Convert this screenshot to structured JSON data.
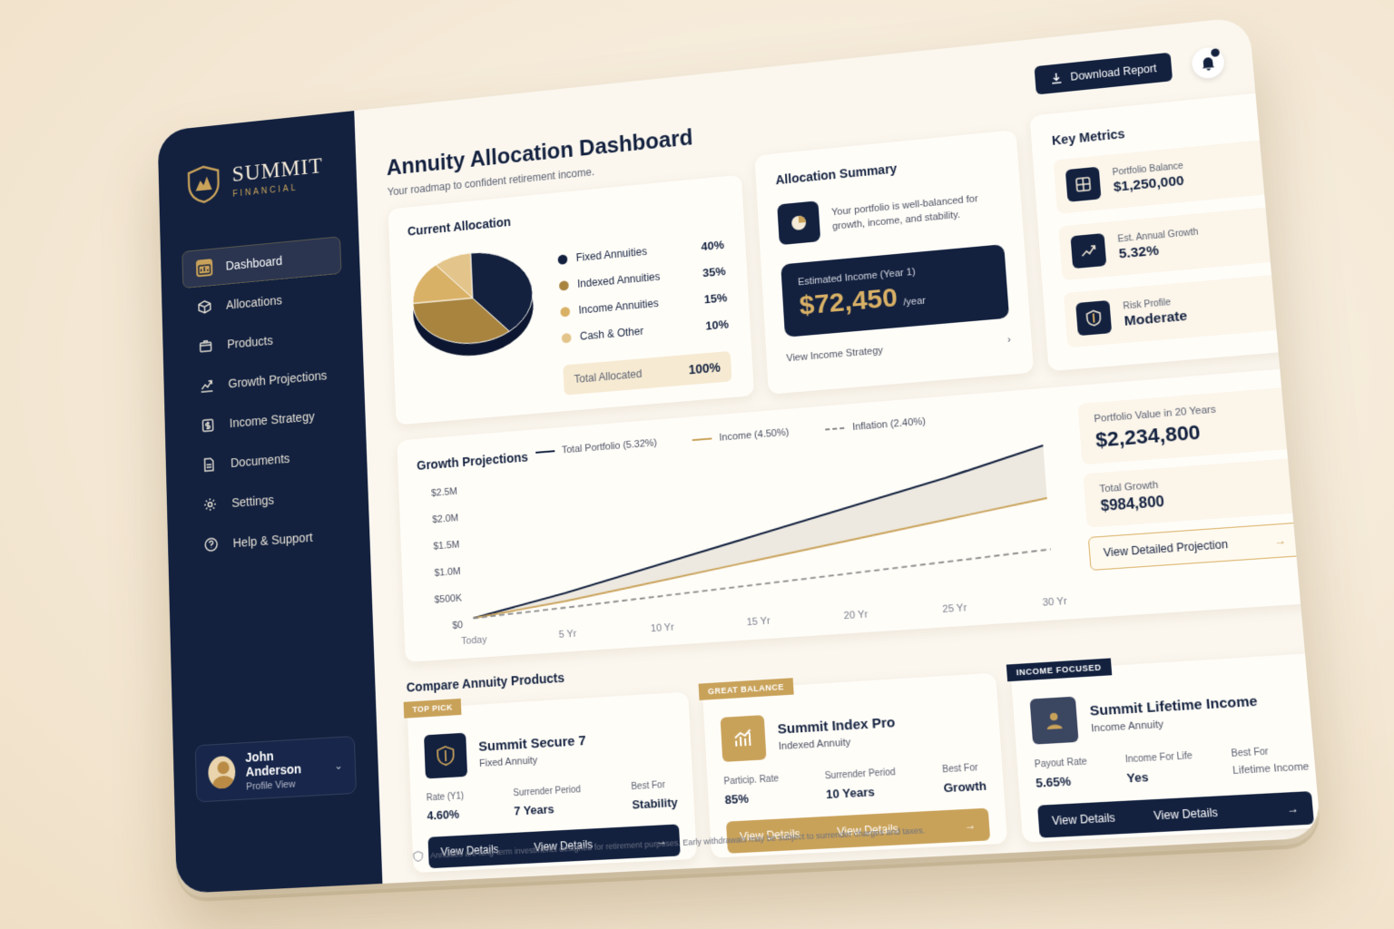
{
  "brand": {
    "name": "SUMMIT",
    "sub": "FINANCIAL"
  },
  "sidebar": {
    "items": [
      {
        "label": "Dashboard",
        "icon": "dashboard-icon"
      },
      {
        "label": "Allocations",
        "icon": "cube-icon"
      },
      {
        "label": "Products",
        "icon": "box-icon"
      },
      {
        "label": "Growth Projections",
        "icon": "chart-icon"
      },
      {
        "label": "Income Strategy",
        "icon": "money-icon"
      },
      {
        "label": "Documents",
        "icon": "document-icon"
      },
      {
        "label": "Settings",
        "icon": "gear-icon"
      },
      {
        "label": "Help & Support",
        "icon": "help-icon"
      }
    ],
    "profile": {
      "name": "John Anderson",
      "sub": "Profile View"
    }
  },
  "header": {
    "title": "Annuity Allocation Dashboard",
    "subtitle": "Your roadmap to confident retirement income.",
    "download_label": "Download Report"
  },
  "allocation": {
    "title": "Current Allocation",
    "items": [
      {
        "label": "Fixed Annuities",
        "pct": "40%",
        "color": "#13213f"
      },
      {
        "label": "Indexed Annuities",
        "pct": "35%",
        "color": "#a8843f"
      },
      {
        "label": "Income Annuities",
        "pct": "15%",
        "color": "#d9b166"
      },
      {
        "label": "Cash & Other",
        "pct": "10%",
        "color": "#e3c48a"
      }
    ],
    "total_label": "Total Allocated",
    "total_value": "100%"
  },
  "summary": {
    "title": "Allocation Summary",
    "text": "Your portfolio is well-balanced for growth, income, and stability.",
    "income_label": "Estimated Income (Year 1)",
    "income_value": "$72,450",
    "income_unit": "/year",
    "link": "View Income Strategy"
  },
  "metrics": {
    "title": "Key Metrics",
    "items": [
      {
        "label": "Portfolio Balance",
        "value": "$1,250,000"
      },
      {
        "label": "Est. Annual Growth",
        "value": "5.32%"
      },
      {
        "label": "Risk Profile",
        "value": "Moderate"
      }
    ]
  },
  "growth": {
    "title": "Growth Projections",
    "stat1_label": "Portfolio Value in 20 Years",
    "stat1_value": "$2,234,800",
    "stat2_label": "Total Growth",
    "stat2_value": "$984,800",
    "button": "View Detailed Projection"
  },
  "chart_data": {
    "type": "line",
    "title": "Growth Projections",
    "x": [
      "Today",
      "5 Yr",
      "10 Yr",
      "15 Yr",
      "20 Yr",
      "25 Yr",
      "30 Yr"
    ],
    "series": [
      {
        "name": "Total Portfolio (5.32%)",
        "values": [
          0.1,
          0.45,
          0.85,
          1.25,
          1.65,
          2.05,
          2.5
        ],
        "color": "#13213f",
        "dash": false
      },
      {
        "name": "Income (4.50%)",
        "values": [
          0.1,
          0.3,
          0.55,
          0.8,
          1.05,
          1.3,
          1.55
        ],
        "color": "#c9a25a",
        "dash": false
      },
      {
        "name": "Inflation (2.40%)",
        "values": [
          0.1,
          0.18,
          0.27,
          0.36,
          0.45,
          0.54,
          0.63
        ],
        "color": "#8a8a8a",
        "dash": true
      }
    ],
    "y_ticks": [
      "$0",
      "$500K",
      "$1.0M",
      "$1.5M",
      "$2.0M",
      "$2.5M"
    ],
    "ylim": [
      0,
      2.5
    ],
    "grid": false,
    "legend": "top"
  },
  "compare": {
    "title": "Compare Annuity Products",
    "products": [
      {
        "ribbon": "TOP PICK",
        "name": "Summit Secure 7",
        "type": "Fixed Annuity",
        "stats": [
          {
            "label": "Rate (Y1)",
            "value": "4.60%"
          },
          {
            "label": "Surrender Period",
            "value": "7 Years"
          },
          {
            "label": "Best For",
            "value": "Stability"
          }
        ],
        "btn1": "View Details",
        "btn2": "View Details"
      },
      {
        "ribbon": "GREAT BALANCE",
        "name": "Summit Index Pro",
        "type": "Indexed Annuity",
        "stats": [
          {
            "label": "Particip. Rate",
            "value": "85%"
          },
          {
            "label": "Surrender Period",
            "value": "10 Years"
          },
          {
            "label": "Best For",
            "value": "Growth"
          }
        ],
        "btn1": "View Details",
        "btn2": "View Details"
      },
      {
        "ribbon": "INCOME FOCUSED",
        "name": "Summit Lifetime Income",
        "type": "Income Annuity",
        "stats": [
          {
            "label": "Payout Rate",
            "value": "5.65%"
          },
          {
            "label": "Income For Life",
            "value": "Yes"
          },
          {
            "label": "Best For",
            "value": "Lifetime Income"
          }
        ],
        "btn1": "View Details",
        "btn2": "View Details"
      }
    ]
  },
  "footer": "Annuities are long-term investments designed for retirement purposes. Early withdrawals may be subject to surrender charges and taxes."
}
